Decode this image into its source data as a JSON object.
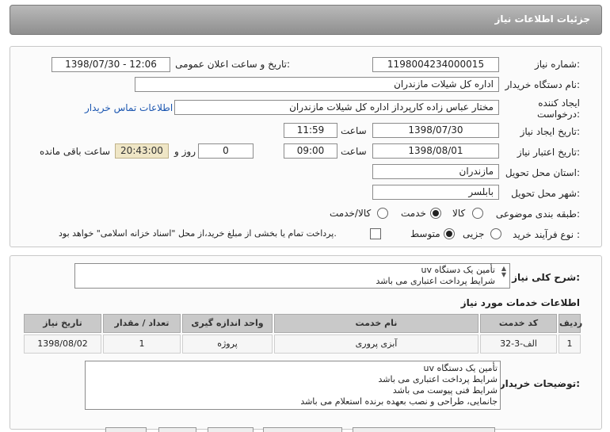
{
  "header": {
    "title": "جزئیات اطلاعات نیاز"
  },
  "form": {
    "need_number_label": "شماره نیاز:",
    "need_number": "1198004234000015",
    "announce_label": "تاریخ و ساعت اعلان عمومی:",
    "announce_value": "1398/07/30 - 12:06",
    "buyer_label": "نام دستگاه خریدار:",
    "buyer_value": "اداره کل شیلات مازندران",
    "creator_label": "ایجاد کننده درخواست:",
    "creator_value": "مختار  عباس زاده  کارپرداز  اداره کل شیلات مازندران",
    "contact_link": "اطلاعات تماس خریدار",
    "create_date_label": "تاریخ ایجاد نیاز:",
    "create_date": "1398/07/30",
    "time_label": "ساعت",
    "create_time": "11:59",
    "validity_label": "تاریخ اعتبار نیاز:",
    "validity_date": "1398/08/01",
    "validity_time": "09:00",
    "days_value": "0",
    "days_label": "روز و",
    "remaining_time": "20:43:00",
    "remaining_label": "ساعت باقی مانده",
    "province_label": "استان محل تحویل:",
    "province_value": "مازندران",
    "city_label": "شهر محل تحویل:",
    "city_value": "بابلسر",
    "category_label": "طبقه بندی موضوعی:",
    "category_options": [
      "کالا",
      "خدمت",
      "کالا/خدمت"
    ],
    "category_selected": "خدمت",
    "process_label": "نوع فرآیند خرید :",
    "process_options": [
      "جزیی",
      "متوسط"
    ],
    "process_selected": "متوسط",
    "payment_note": "پرداخت تمام یا بخشی از مبلغ خرید،از محل \"اسناد خزانه اسلامی\" خواهد بود."
  },
  "description": {
    "label": "شرح کلی نیاز:",
    "lines": [
      "تأمین یک دستگاه  uv",
      "شرایط پرداخت اعتباری می باشد"
    ]
  },
  "services": {
    "title": "اطلاعات خدمات مورد نیاز",
    "columns": [
      "ردیف",
      "کد خدمت",
      "نام خدمت",
      "واحد اندازه گیری",
      "تعداد / مقدار",
      "تاریخ نیاز"
    ],
    "rows": [
      [
        "1",
        "الف-3-32",
        "آبزی پروری",
        "پروژه",
        "1",
        "1398/08/02"
      ]
    ]
  },
  "buyer_notes": {
    "label": "توضیحات خریدار:",
    "lines": [
      "تأمین یک دستگاه  uv",
      "شرایط پرداخت اعتباری می باشد",
      "شرایط فنی پیوست می باشد",
      "جانمایی، طراحی و نصب بعهده برنده استعلام می باشد"
    ]
  }
}
